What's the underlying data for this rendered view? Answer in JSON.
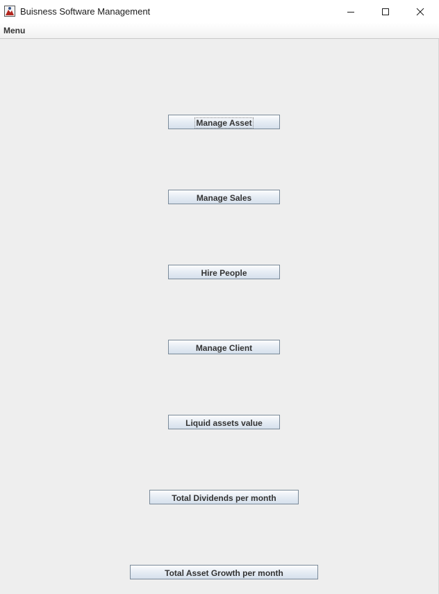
{
  "window": {
    "title": "Buisness Software Management",
    "icon": "java-app-icon",
    "controls": [
      "minimize-icon",
      "maximize-icon",
      "close-icon"
    ]
  },
  "menubar": {
    "items": [
      {
        "label": "Menu"
      }
    ]
  },
  "main": {
    "buttons": [
      {
        "label": "Manage Asset",
        "focused": true
      },
      {
        "label": "Manage Sales"
      },
      {
        "label": "Hire People"
      },
      {
        "label": "Manage Client"
      },
      {
        "label": "Liquid assets value"
      },
      {
        "label": "Total Dividends per month"
      },
      {
        "label": "Total Asset Growth per month"
      }
    ]
  },
  "colors": {
    "background": "#eeeeee",
    "button_border": "#7a8a99",
    "button_text": "#333333"
  }
}
